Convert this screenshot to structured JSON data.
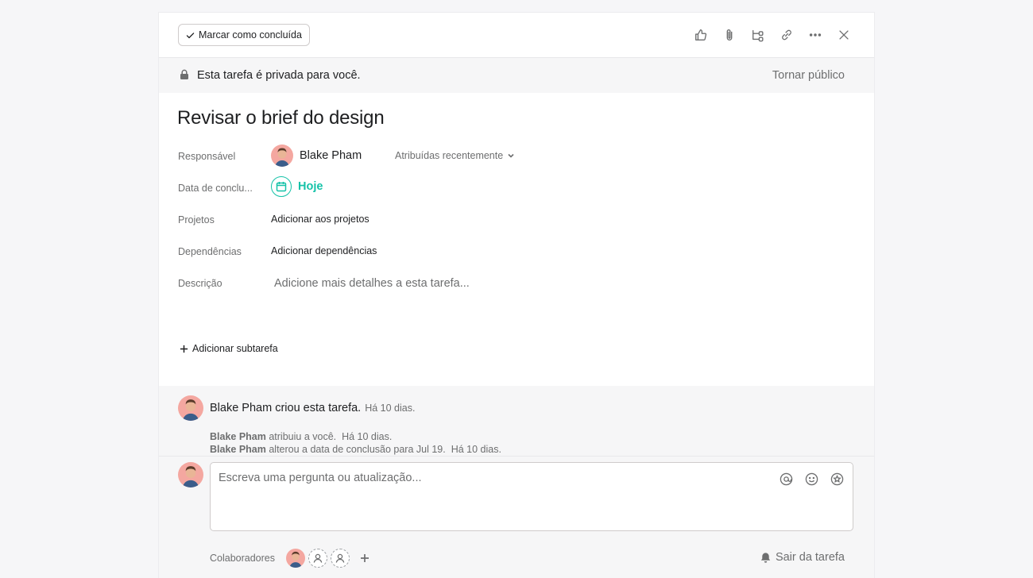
{
  "toolbar": {
    "complete_label": "Marcar como concluída",
    "icons": [
      "like-icon",
      "attachment-icon",
      "subtask-icon",
      "link-icon",
      "more-icon",
      "close-icon"
    ]
  },
  "privacy": {
    "message": "Esta tarefa é privada para você.",
    "make_public": "Tornar público"
  },
  "task": {
    "title": "Revisar o brief do design",
    "fields": {
      "assignee_label": "Responsável",
      "assignee_name": "Blake Pham",
      "recent_label": "Atribuídas recentemente",
      "due_label": "Data de conclu...",
      "due_value": "Hoje",
      "projects_label": "Projetos",
      "projects_value": "Adicionar aos projetos",
      "dependencies_label": "Dependências",
      "dependencies_value": "Adicionar dependências",
      "description_label": "Descrição",
      "description_placeholder": "Adicione mais detalhes a esta tarefa..."
    },
    "add_subtask": "Adicionar subtarefa"
  },
  "activity": {
    "created_text": "Blake Pham criou esta tarefa.",
    "created_time": "Há 10 dias.",
    "stories": [
      {
        "who": "Blake Pham",
        "text": " atribuiu a você.",
        "time": "Há 10 dias."
      },
      {
        "who": "Blake Pham",
        "text": " alterou a data de conclusão para Jul 19.",
        "time": "Há 10 dias."
      }
    ],
    "comment_placeholder": "Escreva uma pergunta ou atualização...",
    "collaborators_label": "Colaboradores",
    "leave_label": "Sair da tarefa"
  },
  "colors": {
    "accent_teal": "#14c2a8",
    "avatar_bg": "#f4a7a0",
    "text_primary": "#1e1f21",
    "text_secondary": "#6d6e6f"
  }
}
